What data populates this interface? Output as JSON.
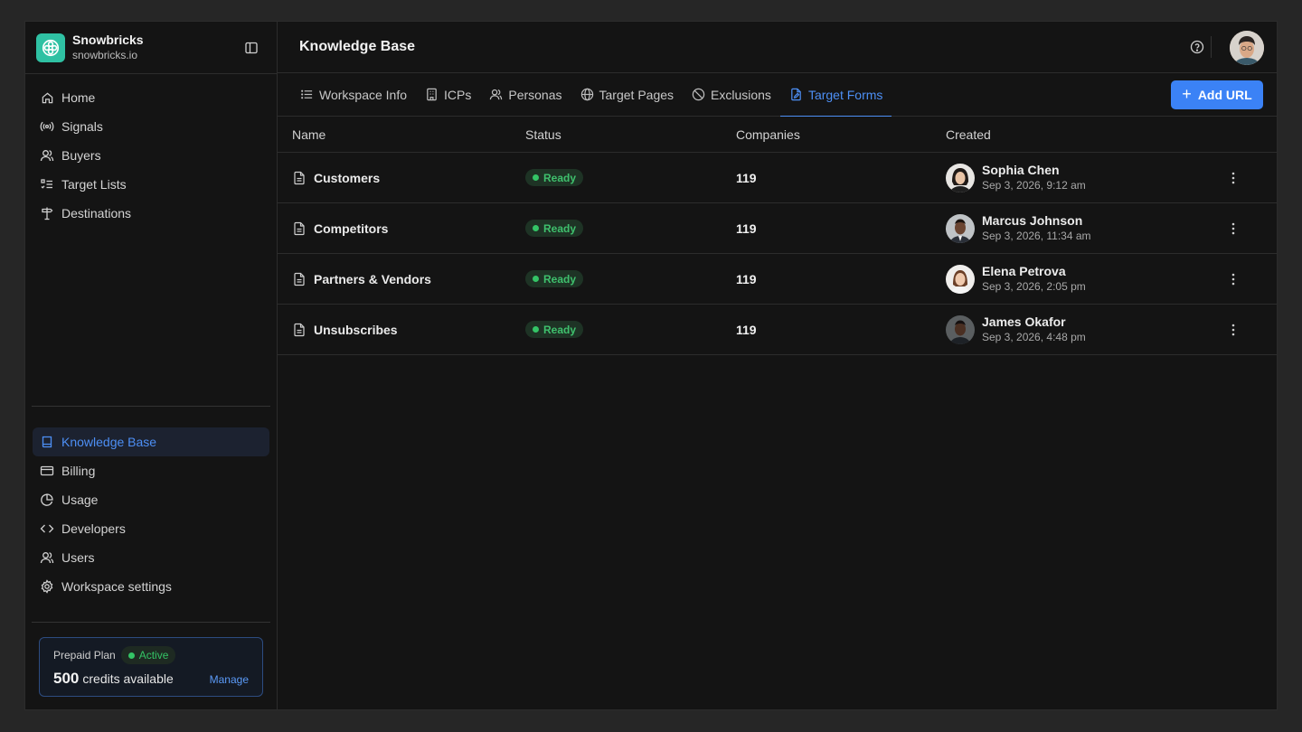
{
  "brand": {
    "name": "Snowbricks",
    "domain": "snowbricks.io"
  },
  "nav_top": [
    {
      "label": "Home",
      "icon": "home-icon"
    },
    {
      "label": "Signals",
      "icon": "signal-icon"
    },
    {
      "label": "Buyers",
      "icon": "user-icon"
    },
    {
      "label": "Target Lists",
      "icon": "list-checks-icon"
    },
    {
      "label": "Destinations",
      "icon": "signpost-icon"
    }
  ],
  "nav_bottom": [
    {
      "label": "Knowledge Base",
      "icon": "book-icon",
      "active": true
    },
    {
      "label": "Billing",
      "icon": "credit-card-icon"
    },
    {
      "label": "Usage",
      "icon": "pie-chart-icon"
    },
    {
      "label": "Developers",
      "icon": "code-icon"
    },
    {
      "label": "Users",
      "icon": "users-icon"
    },
    {
      "label": "Workspace settings",
      "icon": "gear-icon"
    }
  ],
  "plan": {
    "label": "Prepaid Plan",
    "status": "Active",
    "credits": "500",
    "credits_label": "credits available",
    "manage": "Manage"
  },
  "header": {
    "title": "Knowledge Base"
  },
  "tabs": [
    {
      "label": "Workspace Info",
      "icon": "list-icon"
    },
    {
      "label": "ICPs",
      "icon": "building-icon"
    },
    {
      "label": "Personas",
      "icon": "users-icon"
    },
    {
      "label": "Target Pages",
      "icon": "globe-icon"
    },
    {
      "label": "Exclusions",
      "icon": "ban-icon"
    },
    {
      "label": "Target Forms",
      "icon": "file-pen-icon",
      "active": true
    }
  ],
  "add_button": {
    "label": "Add URL"
  },
  "table": {
    "columns": [
      "Name",
      "Status",
      "Companies",
      "Created"
    ],
    "rows": [
      {
        "name": "Customers",
        "status": "Ready",
        "companies": "119",
        "creator": "Sophia Chen",
        "date": "Sep 3, 2026, 9:12 am"
      },
      {
        "name": "Competitors",
        "status": "Ready",
        "companies": "119",
        "creator": "Marcus Johnson",
        "date": "Sep 3, 2026, 11:34 am"
      },
      {
        "name": "Partners & Vendors",
        "status": "Ready",
        "companies": "119",
        "creator": "Elena Petrova",
        "date": "Sep 3, 2026, 2:05 pm"
      },
      {
        "name": "Unsubscribes",
        "status": "Ready",
        "companies": "119",
        "creator": "James Okafor",
        "date": "Sep 3, 2026, 4:48 pm"
      }
    ]
  },
  "colors": {
    "accent": "#3b82f6",
    "brand": "#2fc1a3",
    "ready": "#34c466",
    "background": "#141414"
  }
}
